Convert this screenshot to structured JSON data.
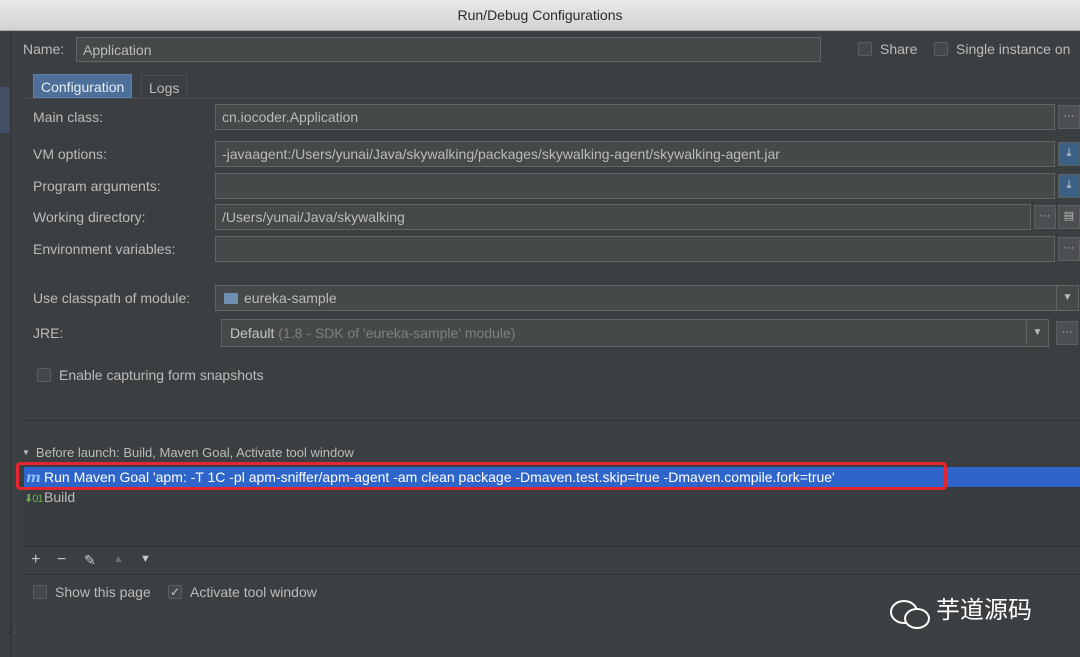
{
  "window": {
    "title": "Run/Debug Configurations"
  },
  "name_row": {
    "label": "Name:",
    "value": "Application",
    "share_label": "Share",
    "single_instance_label": "Single instance on"
  },
  "tabs": [
    {
      "label": "Configuration",
      "active": true
    },
    {
      "label": "Logs",
      "active": false
    }
  ],
  "config": {
    "main_class": {
      "label": "Main class:",
      "value": "cn.iocoder.Application"
    },
    "vm_options": {
      "label": "VM options:",
      "value": "-javaagent:/Users/yunai/Java/skywalking/packages/skywalking-agent/skywalking-agent.jar"
    },
    "program_args": {
      "label": "Program arguments:",
      "value": ""
    },
    "working_dir": {
      "label": "Working directory:",
      "value": "/Users/yunai/Java/skywalking"
    },
    "env_vars": {
      "label": "Environment variables:",
      "value": ""
    },
    "classpath": {
      "label": "Use classpath of module:",
      "value": "eureka-sample"
    },
    "jre": {
      "label": "JRE:",
      "value": "Default",
      "hint": "(1.8 - SDK of 'eureka-sample' module)"
    },
    "snapshots": {
      "label": "Enable capturing form snapshots",
      "checked": false
    }
  },
  "before_launch": {
    "header": "Before launch: Build, Maven Goal, Activate tool window",
    "items": [
      {
        "icon": "maven-icon",
        "label": "Run Maven Goal 'apm: -T 1C -pl apm-sniffer/apm-agent -am clean  package -Dmaven.test.skip=true -Dmaven.compile.fork=true'",
        "selected": true
      },
      {
        "icon": "build-icon",
        "label": "Build",
        "selected": false
      }
    ],
    "toolbar": {
      "add": "+",
      "remove": "−",
      "edit": "✎",
      "up": "▲",
      "down": "▼"
    }
  },
  "footer": {
    "show_page_label": "Show this page",
    "show_page_checked": false,
    "activate_label": "Activate tool window",
    "activate_checked": true
  },
  "watermark": {
    "text": "芋道源码"
  },
  "colors": {
    "accent": "#4e6f99",
    "selection": "#2f65ca",
    "highlight_box": "#e5262f",
    "background": "#3c3f41"
  }
}
